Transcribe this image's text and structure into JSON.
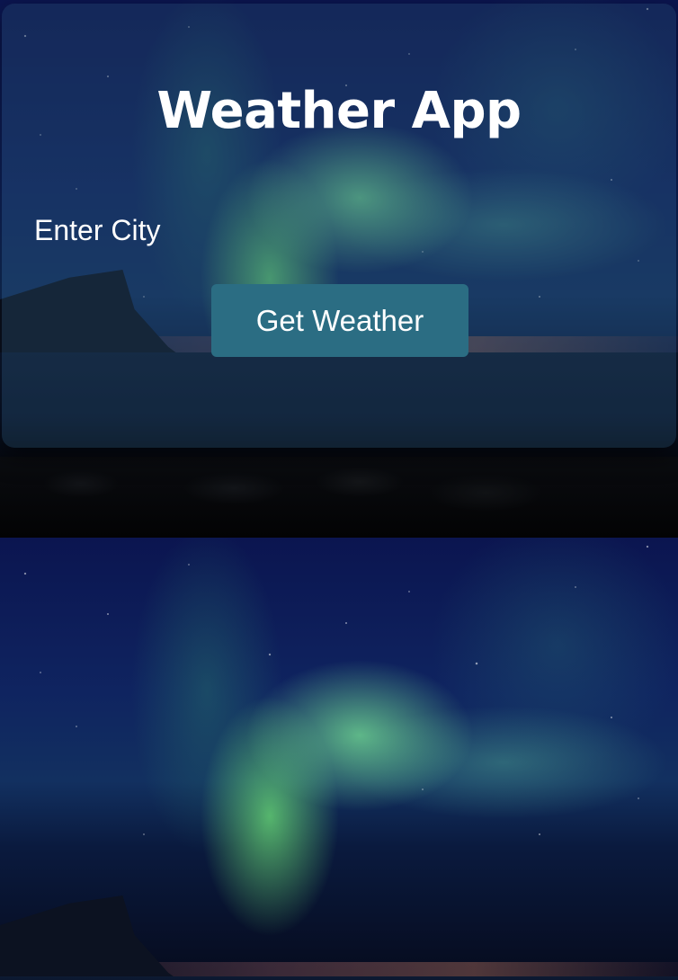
{
  "app": {
    "title": "Weather App"
  },
  "form": {
    "city_label": "Enter City",
    "city_value": "",
    "submit_label": "Get Weather"
  },
  "theme": {
    "button_color": "#2b6d83",
    "text_color": "#ffffff",
    "background": "aurora-night-sky"
  }
}
